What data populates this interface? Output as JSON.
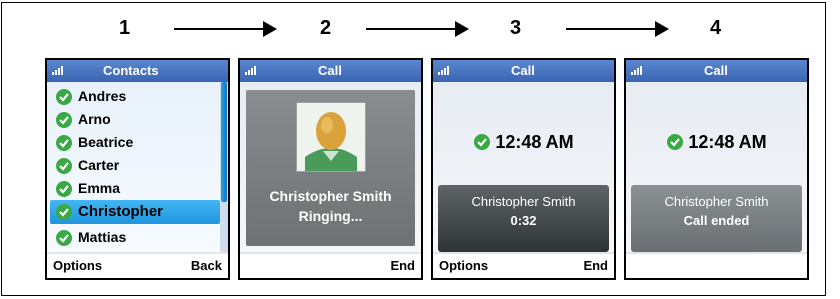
{
  "steps": [
    "1",
    "2",
    "3",
    "4"
  ],
  "phones": [
    {
      "title": "Contacts",
      "contacts": [
        "Andres",
        "Arno",
        "Beatrice",
        "Carter",
        "Emma",
        "Christopher",
        "Mattias"
      ],
      "selected_contact": "Christopher",
      "softkey_left": "Options",
      "softkey_right": "Back"
    },
    {
      "title": "Call",
      "caller_name": "Christopher Smith",
      "status": "Ringing...",
      "softkey_left": "",
      "softkey_right": "End"
    },
    {
      "title": "Call",
      "time": "12:48 AM",
      "caller_name": "Christopher Smith",
      "duration": "0:32",
      "softkey_left": "Options",
      "softkey_right": "End"
    },
    {
      "title": "Call",
      "time": "12:48 AM",
      "caller_name": "Christopher Smith",
      "status": "Call ended",
      "softkey_left": "",
      "softkey_right": ""
    }
  ],
  "colors": {
    "titlebar": "#3a64b3",
    "selection": "#1e95de",
    "presence_green": "#3aa845"
  },
  "icons": [
    "signal-icon",
    "presence-available-icon",
    "contact-avatar-icon",
    "arrow-icon"
  ]
}
